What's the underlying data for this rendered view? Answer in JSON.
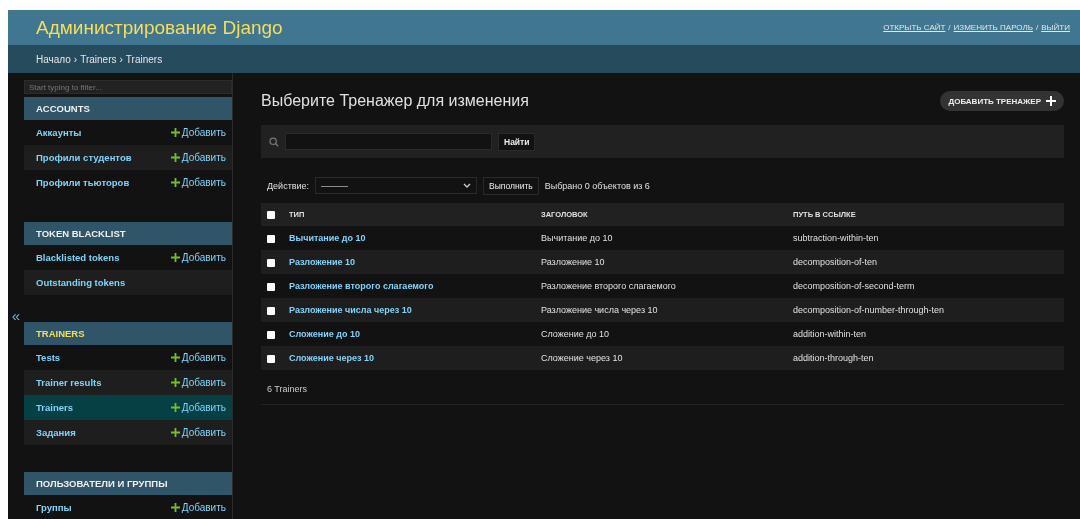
{
  "header": {
    "title": "Администрирование Django",
    "user_tools": [
      "ОТКРЫТЬ САЙТ",
      "ИЗМЕНИТЬ ПАРОЛЬ",
      "ВЫЙТИ"
    ],
    "separator": "/"
  },
  "breadcrumbs": {
    "items": [
      "Начало",
      "Trainers",
      "Trainers"
    ],
    "separator": "›"
  },
  "sidebar": {
    "filter_placeholder": "Start typing to filter...",
    "collapse_toggle": "«",
    "modules": [
      {
        "caption": "ACCOUNTS",
        "selected": false,
        "models": [
          {
            "name": "Аккаунты",
            "add": "Добавить",
            "selected": false
          },
          {
            "name": "Профили студентов",
            "add": "Добавить",
            "selected": false
          },
          {
            "name": "Профили тьюторов",
            "add": "Добавить",
            "selected": false
          }
        ]
      },
      {
        "caption": "TOKEN BLACKLIST",
        "selected": false,
        "models": [
          {
            "name": "Blacklisted tokens",
            "add": "Добавить",
            "selected": false
          },
          {
            "name": "Outstanding tokens",
            "selected": false
          }
        ]
      },
      {
        "caption": "TRAINERS",
        "selected": true,
        "models": [
          {
            "name": "Tests",
            "add": "Добавить",
            "selected": false
          },
          {
            "name": "Trainer results",
            "add": "Добавить",
            "selected": false
          },
          {
            "name": "Trainers",
            "add": "Добавить",
            "selected": true
          },
          {
            "name": "Задания",
            "add": "Добавить",
            "selected": false
          }
        ]
      },
      {
        "caption": "ПОЛЬЗОВАТЕЛИ И ГРУППЫ",
        "selected": false,
        "models": [
          {
            "name": "Группы",
            "add": "Добавить",
            "selected": false
          }
        ]
      }
    ]
  },
  "main": {
    "title": "Выберите Тренажер для изменения",
    "add_button": "ДОБАВИТЬ ТРЕНАЖЕР",
    "search_button": "Найти",
    "actions": {
      "label": "Действие:",
      "select_value": "———",
      "go_button": "Выполнить",
      "counter": "Выбрано 0 объектов из 6"
    },
    "table": {
      "select_all": false,
      "columns": [
        "ТИП",
        "ЗАГОЛОВОК",
        "ПУТЬ В ССЫЛКЕ"
      ],
      "rows": [
        {
          "checked": false,
          "cells": [
            "Вычитание до 10",
            "Вычитание до 10",
            "subtraction-within-ten"
          ]
        },
        {
          "checked": false,
          "cells": [
            "Разложение 10",
            "Разложение 10",
            "decomposition-of-ten"
          ]
        },
        {
          "checked": false,
          "cells": [
            "Разложение второго слагаемого",
            "Разложение второго слагаемого",
            "decomposition-of-second-term"
          ]
        },
        {
          "checked": false,
          "cells": [
            "Разложение числа через 10",
            "Разложение числа через 10",
            "decomposition-of-number-through-ten"
          ]
        },
        {
          "checked": false,
          "cells": [
            "Сложение до 10",
            "Сложение до 10",
            "addition-within-ten"
          ]
        },
        {
          "checked": false,
          "cells": [
            "Сложение через 10",
            "Сложение через 10",
            "addition-through-ten"
          ]
        }
      ]
    },
    "paginator": "6 Trainers"
  }
}
